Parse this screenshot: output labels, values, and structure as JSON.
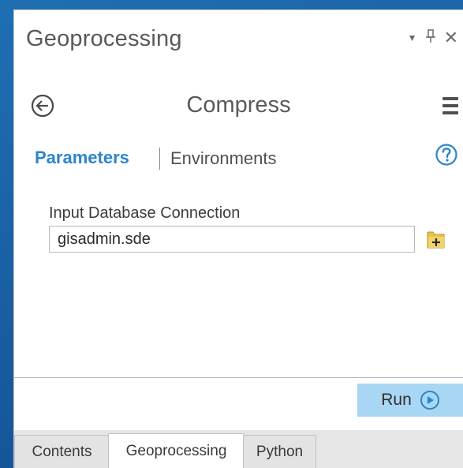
{
  "pane": {
    "title": "Geoprocessing",
    "controls": {
      "dropdown_icon": "dropdown-arrow-icon",
      "pin_icon": "pin-icon",
      "close_icon": "close-icon"
    }
  },
  "tool": {
    "title": "Compress",
    "back_icon": "back-arrow-icon",
    "menu_icon": "hamburger-menu-icon"
  },
  "tabs": {
    "parameters": "Parameters",
    "environments": "Environments",
    "help_icon": "help-icon"
  },
  "parameters": {
    "input_database_connection": {
      "label": "Input Database Connection",
      "value": "gisadmin.sde",
      "browse_icon": "browse-folder-icon"
    }
  },
  "actions": {
    "run_label": "Run",
    "run_icon": "play-icon"
  },
  "bottom_tabs": [
    {
      "label": "Contents",
      "active": false
    },
    {
      "label": "Geoprocessing",
      "active": true
    },
    {
      "label": "Python",
      "active": false
    }
  ],
  "colors": {
    "accent_blue": "#2b85c9",
    "run_button_bg": "#a9d6f2",
    "desktop_bg": "#1b63a6"
  }
}
